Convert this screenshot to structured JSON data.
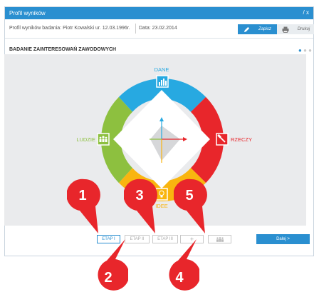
{
  "window": {
    "title": "Profil wyników",
    "controls": "/ x"
  },
  "info": {
    "person": "Profil wyników badania: Piotr Kowalski ur. 12.03.1996r.",
    "date": "Data: 23.02.2014",
    "save_label": "Zapisz",
    "print_label": "Drukuj"
  },
  "section": {
    "title": "BADANIE ZAINTERESOWAŃ ZAWODOWYCH"
  },
  "wheel": {
    "segments": [
      {
        "label": "DANE",
        "color": "#27a9e1"
      },
      {
        "label": "RZECZY",
        "color": "#e8262b"
      },
      {
        "label": "IDEE",
        "color": "#f9b50f"
      },
      {
        "label": "LUDZIE",
        "color": "#8dc03f"
      }
    ]
  },
  "bottom": {
    "etaps": [
      "ETAP I",
      "ETAP II",
      "ETAP III"
    ],
    "add_label": "+",
    "next_label": "Dalej  >"
  },
  "callouts": [
    "1",
    "2",
    "3",
    "4",
    "5"
  ],
  "colors": {
    "accent": "#2a8fd0",
    "callout": "#e8262b"
  }
}
